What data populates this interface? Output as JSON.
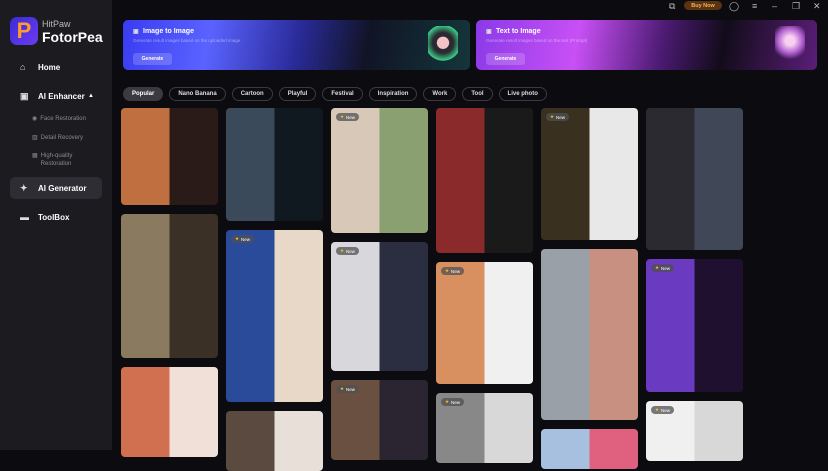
{
  "app": {
    "brand_small": "HitPaw",
    "brand_large": "FotorPea",
    "logo_letter": "P"
  },
  "titlebar": {
    "buy_label": "Buy Now",
    "icons": [
      "gallery-icon",
      "account-icon",
      "menu-icon",
      "minimize-icon",
      "restore-icon",
      "close-icon"
    ]
  },
  "sidebar": {
    "home": "Home",
    "ai_enhancer": "AI Enhancer",
    "sub_items": [
      "Face Restoration",
      "Detail Recovery",
      "High-quality Restoration"
    ],
    "ai_generator": "AI Generator",
    "toolbox": "ToolBox"
  },
  "banners": [
    {
      "title": "Image to Image",
      "subtitle": "Generate result images based on the uploaded image",
      "button": "Generate"
    },
    {
      "title": "Text to Image",
      "subtitle": "Generate result images based on the text (Prompt)",
      "button": "Generate"
    }
  ],
  "tags": [
    "Popular",
    "Nano Banana",
    "Cartoon",
    "Playful",
    "Festival",
    "Inspiration",
    "Work",
    "Tool",
    "Live photo"
  ],
  "active_tag": "Popular",
  "badge_label": "New",
  "gallery": [
    [
      {
        "new": false,
        "colors": [
          "#c07040",
          "#2a1a18"
        ]
      },
      {
        "new": false,
        "colors": [
          "#8a7a60",
          "#3a3025"
        ]
      },
      {
        "new": false,
        "colors": [
          "#d07050",
          "#f0e0d8"
        ]
      }
    ],
    [
      {
        "new": false,
        "colors": [
          "#3a4a5a",
          "#101820"
        ]
      },
      {
        "new": true,
        "colors": [
          "#2a4a9a",
          "#e8d8c8"
        ]
      },
      {
        "new": false,
        "colors": [
          "#5a4a40",
          "#e8e0d8"
        ]
      }
    ],
    [
      {
        "new": true,
        "colors": [
          "#d8c8b8",
          "#8aa070"
        ]
      },
      {
        "new": true,
        "colors": [
          "#d8d8dc",
          "#2a2e40"
        ]
      },
      {
        "new": true,
        "colors": [
          "#6a5040",
          "#2a2530"
        ]
      }
    ],
    [
      {
        "new": false,
        "colors": [
          "#8a2a2a",
          "#1a1a1a"
        ]
      },
      {
        "new": true,
        "colors": [
          "#d89060",
          "#f0f0f0"
        ]
      },
      {
        "new": true,
        "colors": [
          "#888",
          "#d8d8d8"
        ]
      }
    ],
    [
      {
        "new": true,
        "colors": [
          "#3a3020",
          "#e8e8e8"
        ]
      },
      {
        "new": false,
        "colors": [
          "#9aa0a8",
          "#c89080"
        ]
      },
      {
        "new": false,
        "colors": [
          "#a8c0e0",
          "#e06080"
        ]
      }
    ],
    [
      {
        "new": false,
        "colors": [
          "#2a2a30",
          "#404858"
        ]
      },
      {
        "new": true,
        "colors": [
          "#6a3ac0",
          "#201030"
        ]
      },
      {
        "new": true,
        "colors": [
          "#f0f0f0",
          "#d8d8d8"
        ]
      }
    ]
  ]
}
